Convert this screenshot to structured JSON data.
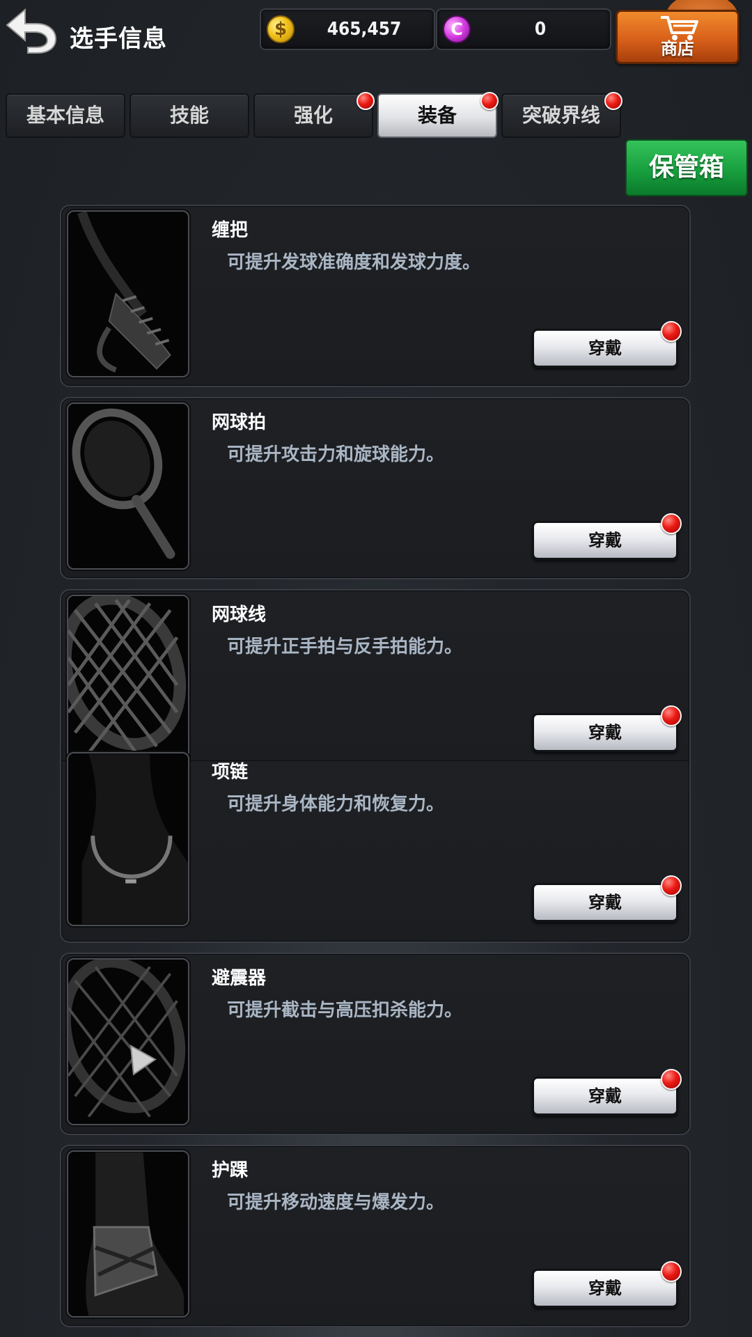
{
  "header": {
    "title": "选手信息",
    "gold": "465,457",
    "gems": "0",
    "shop_label": "商店",
    "icons": {
      "back": "back-arrow-icon",
      "gold": "gold-coin-icon",
      "gem": "purple-gem-icon",
      "shop": "shopping-cart-icon"
    }
  },
  "tabs": [
    {
      "label": "基本信息",
      "active": false,
      "badge": false
    },
    {
      "label": "技能",
      "active": false,
      "badge": false
    },
    {
      "label": "强化",
      "active": false,
      "badge": true
    },
    {
      "label": "装备",
      "active": true,
      "badge": true
    },
    {
      "label": "突破界线",
      "active": false,
      "badge": true
    }
  ],
  "storage_button": "保管箱",
  "equipment": [
    {
      "name": "缠把",
      "description": "可提升发球准确度和发球力度。",
      "button": "穿戴",
      "badge": true
    },
    {
      "name": "网球拍",
      "description": "可提升攻击力和旋球能力。",
      "button": "穿戴",
      "badge": true
    },
    {
      "name": "网球线",
      "description": "可提升正手拍与反手拍能力。",
      "button": "穿戴",
      "badge": true
    },
    {
      "name": "项链",
      "description": "可提升身体能力和恢复力。",
      "button": "穿戴",
      "badge": true
    },
    {
      "name": "避震器",
      "description": "可提升截击与高压扣杀能力。",
      "button": "穿戴",
      "badge": true
    },
    {
      "name": "护踝",
      "description": "可提升移动速度与爆发力。",
      "button": "穿戴",
      "badge": true
    }
  ],
  "colors": {
    "badge_red": "#ea1a14",
    "shop_orange": "#d8601a",
    "storage_green": "#18a03f",
    "description_text": "#aab6c4"
  }
}
